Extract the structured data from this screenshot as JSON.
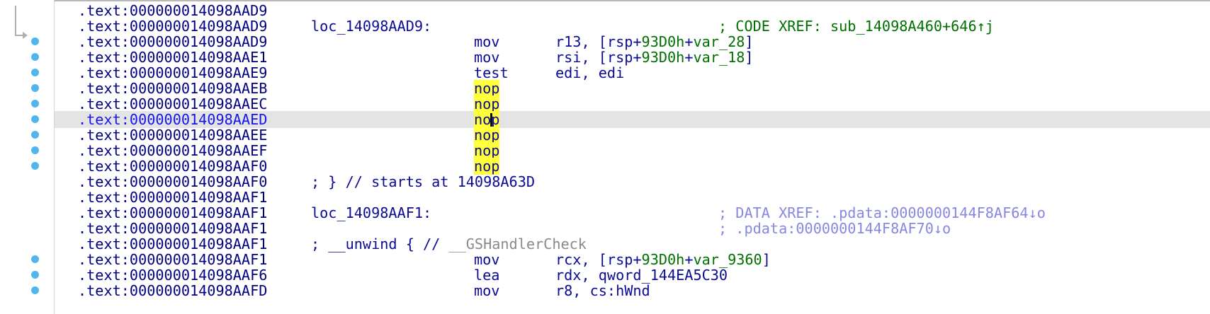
{
  "gutter": {
    "arrow_icon": "jump-flow-arrow-icon",
    "breakpoint_color": "#52b6ee"
  },
  "colors": {
    "address": "#000080",
    "code": "#0b0b95",
    "comment_green": "#007000",
    "data_xref": "#8787e2",
    "highlight_yellow": "#ffff3a",
    "current_line": "#e4e4e4"
  },
  "lines": [
    {
      "addr": ".text:000000014098AAD9"
    },
    {
      "addr": ".text:000000014098AAD9",
      "label": "loc_14098AAD9:",
      "comment": "; CODE XREF: sub_14098A460+646↑j"
    },
    {
      "addr": ".text:000000014098AAD9",
      "mnem": "mov",
      "ops": [
        [
          "r13, [rsp+",
          "c"
        ],
        [
          "93D0h",
          "g"
        ],
        [
          "+",
          "c"
        ],
        [
          "var_28",
          "g"
        ],
        [
          "]",
          "c"
        ]
      ]
    },
    {
      "addr": ".text:000000014098AAE1",
      "mnem": "mov",
      "ops": [
        [
          "rsi, [rsp+",
          "c"
        ],
        [
          "93D0h",
          "g"
        ],
        [
          "+",
          "c"
        ],
        [
          "var_18",
          "g"
        ],
        [
          "]",
          "c"
        ]
      ]
    },
    {
      "addr": ".text:000000014098AAE9",
      "mnem": "test",
      "ops": [
        [
          "edi, edi",
          "c"
        ]
      ]
    },
    {
      "addr": ".text:000000014098AAEB",
      "mnem": "nop",
      "yellow": true
    },
    {
      "addr": ".text:000000014098AAEC",
      "mnem": "nop",
      "yellow": true
    },
    {
      "addr": ".text:000000014098AAED",
      "mnem": "nop",
      "yellow": true,
      "current": true
    },
    {
      "addr": ".text:000000014098AAEE",
      "mnem": "nop",
      "yellow": true
    },
    {
      "addr": ".text:000000014098AAEF",
      "mnem": "nop",
      "yellow": true
    },
    {
      "addr": ".text:000000014098AAF0",
      "mnem": "nop",
      "yellow": true
    },
    {
      "addr": ".text:000000014098AAF0",
      "inline": "; } // starts at 14098A63D"
    },
    {
      "addr": ".text:000000014098AAF1"
    },
    {
      "addr": ".text:000000014098AAF1",
      "label": "loc_14098AAF1:",
      "comment": "; DATA XREF: .pdata:0000000144F8AF64↓o",
      "data": true
    },
    {
      "addr": ".text:000000014098AAF1",
      "comment": "; .pdata:0000000144F8AF70↓o",
      "data": true
    },
    {
      "addr": ".text:000000014098AAF1",
      "inline": "; __unwind { // __GSHandlerCheck",
      "inline_tail_gray": true
    },
    {
      "addr": ".text:000000014098AAF1",
      "mnem": "mov",
      "ops": [
        [
          "rcx, [rsp+",
          "c"
        ],
        [
          "93D0h",
          "g"
        ],
        [
          "+",
          "c"
        ],
        [
          "var_9360",
          "g"
        ],
        [
          "]",
          "c"
        ]
      ]
    },
    {
      "addr": ".text:000000014098AAF6",
      "mnem": "lea",
      "ops": [
        [
          "rdx, qword_144EA5C30",
          "c"
        ]
      ]
    },
    {
      "addr": ".text:000000014098AAFD",
      "mnem": "mov",
      "ops": [
        [
          "r8, cs:hWnd",
          "c"
        ]
      ]
    }
  ]
}
